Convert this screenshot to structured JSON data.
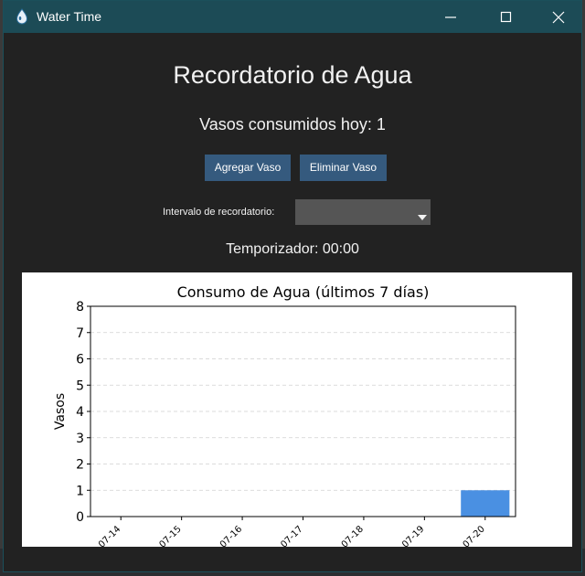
{
  "window": {
    "title": "Water Time",
    "controls": {
      "minimize": "minimize",
      "maximize": "maximize",
      "close": "close"
    }
  },
  "app": {
    "title": "Recordatorio de Agua",
    "count_text": "Vasos consumidos hoy: 1",
    "add_button": "Agregar Vaso",
    "remove_button": "Eliminar Vaso",
    "interval_label": "Intervalo de recordatorio:",
    "interval_value": "",
    "timer_text": "Temporizador: 00:00"
  },
  "colors": {
    "titlebar": "#1c4b56",
    "background": "#222222",
    "button": "#355a7e",
    "dropdown": "#555555",
    "bar": "#4a90e2"
  },
  "chart_data": {
    "type": "bar",
    "title": "Consumo de Agua (últimos 7 días)",
    "xlabel": "",
    "ylabel": "Vasos",
    "categories": [
      "07-14",
      "07-15",
      "07-16",
      "07-17",
      "07-18",
      "07-19",
      "07-20"
    ],
    "category_tick_labels": [
      "07-14",
      "07-15",
      "07-16",
      "07-17",
      "07-18",
      "07-19",
      "07-20"
    ],
    "values": [
      0,
      0,
      0,
      0,
      0,
      0,
      1
    ],
    "ylim": [
      0,
      8
    ],
    "yticks": [
      0,
      1,
      2,
      3,
      4,
      5,
      6,
      7,
      8
    ],
    "grid": "horizontal dashed",
    "legend": "none"
  }
}
